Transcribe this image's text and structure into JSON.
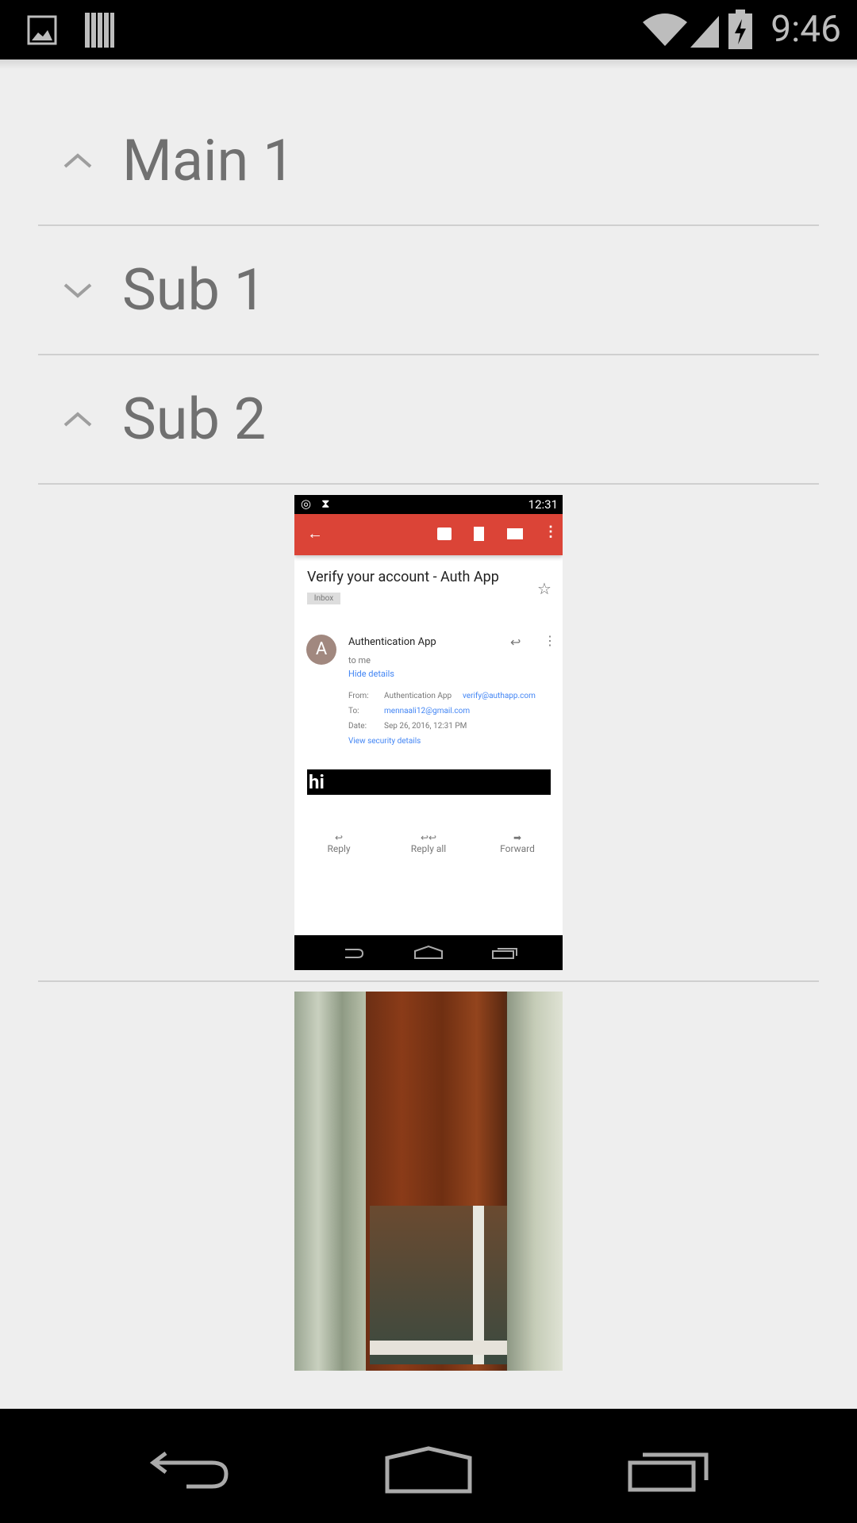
{
  "status_bar": {
    "time": "9:46",
    "icons": [
      "image-icon",
      "barcode-icon",
      "wifi-icon",
      "signal-icon",
      "battery-charging-icon"
    ]
  },
  "accordion": [
    {
      "label": "Main 1",
      "state": "expanded"
    },
    {
      "label": "Sub 1",
      "state": "collapsed"
    },
    {
      "label": "Sub 2",
      "state": "expanded"
    }
  ],
  "screenshot": {
    "time": "12:31",
    "subject": "Verify your account - Auth App",
    "badge": "Inbox",
    "avatar_letter": "A",
    "sender": "Authentication App",
    "to_me": "to me",
    "hide_details": "Hide details",
    "from_label": "From:",
    "from_name": "Authentication App",
    "from_email": "verify@authapp.com",
    "to_label": "To:",
    "to_email": "mennaali12@gmail.com",
    "date_label": "Date:",
    "date": "Sep 26, 2016, 12:31 PM",
    "security": "View security details",
    "body": "hi",
    "actions": [
      "Reply",
      "Reply all",
      "Forward"
    ],
    "toolbar_color": "#db4437"
  }
}
